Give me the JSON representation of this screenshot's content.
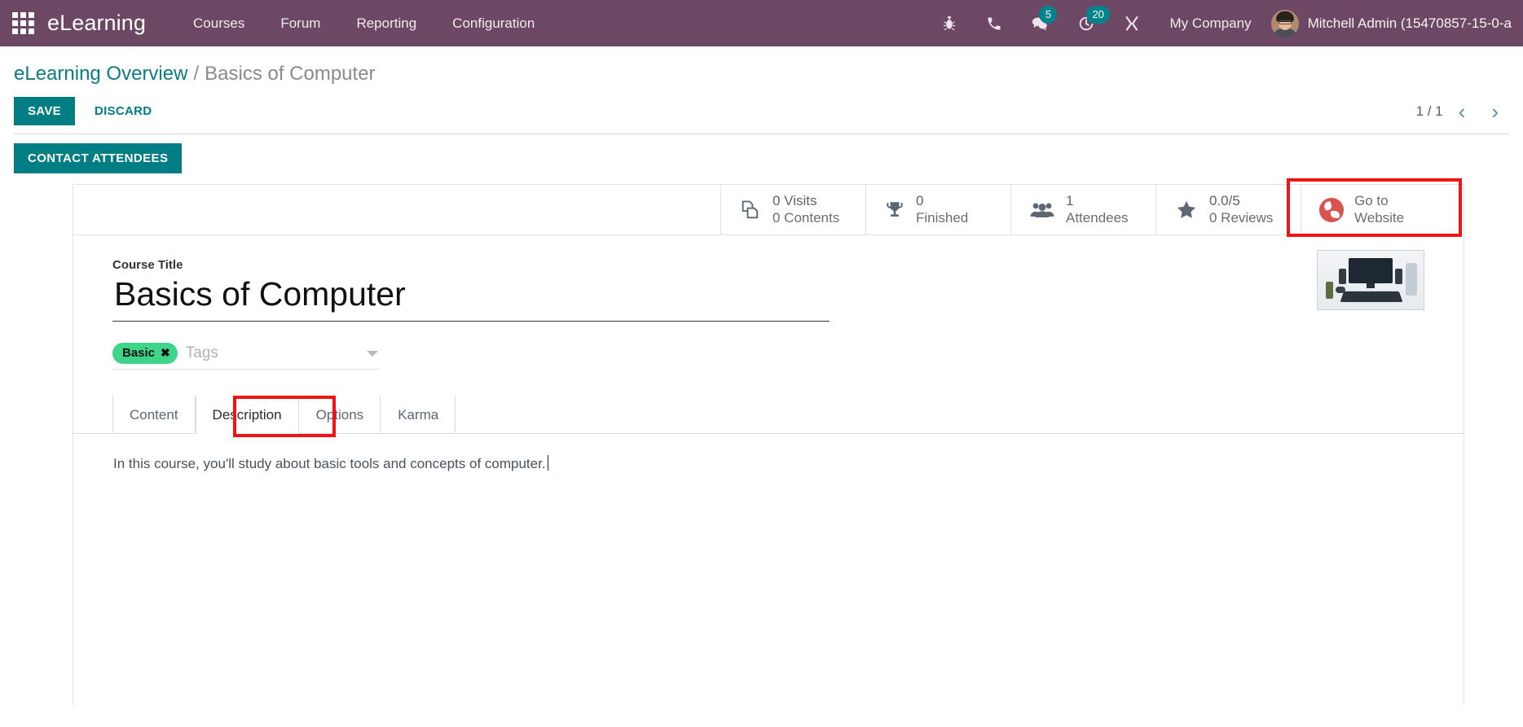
{
  "navbar": {
    "apps_icon": "apps-grid-icon",
    "brand": "eLearning",
    "menu": [
      {
        "label": "Courses"
      },
      {
        "label": "Forum"
      },
      {
        "label": "Reporting"
      },
      {
        "label": "Configuration"
      }
    ],
    "sys_icons": [
      {
        "name": "bug-icon",
        "badge": null
      },
      {
        "name": "phone-icon",
        "badge": null
      },
      {
        "name": "messages-icon",
        "badge": "5"
      },
      {
        "name": "activities-clock-icon",
        "badge": "20"
      },
      {
        "name": "tools-wrench-icon",
        "badge": null
      }
    ],
    "company": "My Company",
    "user": "Mitchell Admin (15470857-15-0-a"
  },
  "breadcrumb": {
    "parent": "eLearning Overview",
    "separator": "/",
    "current": "Basics of Computer"
  },
  "control_panel": {
    "save_label": "SAVE",
    "discard_label": "DISCARD",
    "contact_attendees_label": "CONTACT ATTENDEES",
    "pager_count": "1 / 1",
    "pager_prev": "‹",
    "pager_next": "›"
  },
  "stat_buttons": [
    {
      "icon": "pages-copy-icon",
      "line1": "0 Visits",
      "line2": "0 Contents"
    },
    {
      "icon": "trophy-icon",
      "line1": "0",
      "line2": "Finished"
    },
    {
      "icon": "people-group-icon",
      "line1": "1",
      "line2": "Attendees"
    },
    {
      "icon": "star-icon",
      "line1": "0.0/5",
      "line2": "0 Reviews"
    },
    {
      "icon": "globe-icon",
      "line1": "Go to",
      "line2": "Website"
    }
  ],
  "form": {
    "course_title_label": "Course Title",
    "course_title_value": "Basics of Computer",
    "tag": "Basic",
    "tag_remove": "✖",
    "tags_placeholder": "Tags",
    "image_alt": "computer-desk-thumbnail"
  },
  "notebook": {
    "tabs": [
      {
        "label": "Content",
        "active": false
      },
      {
        "label": "Description",
        "active": true
      },
      {
        "label": "Options",
        "active": false
      },
      {
        "label": "Karma",
        "active": false
      }
    ],
    "description_text": "In this course, you'll study about basic tools and concepts of computer."
  },
  "colors": {
    "navbar_bg": "#6d4864",
    "accent_teal": "#017e84",
    "breadcrumb_link": "#0a7c86",
    "badge_bg": "#00848b",
    "tag_green": "#3ed48a",
    "highlight_red": "#f01414",
    "globe_red": "#d9534f"
  },
  "annotations": [
    {
      "name": "highlight-go-to-website",
      "color": "#f01414"
    },
    {
      "name": "highlight-description-tab",
      "color": "#f01414"
    }
  ]
}
